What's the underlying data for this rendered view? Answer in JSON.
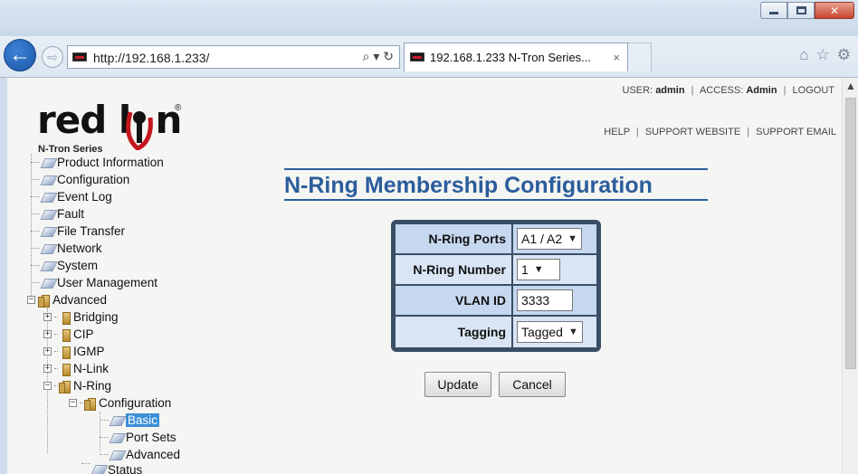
{
  "browser": {
    "url": "http://192.168.1.233/",
    "tab_title": "192.168.1.233 N-Tron Series...",
    "tab_close": "×",
    "search_glyph": "⌕ ▾ ↻",
    "icons": [
      "back-arrow-icon",
      "forward-arrow-icon",
      "home-icon",
      "star-icon",
      "gear-icon"
    ]
  },
  "logo": {
    "brand": "red lion",
    "subtitle": "N-Tron Series"
  },
  "header": {
    "user_label": "USER:",
    "user_value": "admin",
    "access_label": "ACCESS:",
    "access_value": "Admin",
    "logout": "LOGOUT",
    "help": "HELP",
    "support_website": "SUPPORT WEBSITE",
    "support_email": "SUPPORT EMAIL"
  },
  "tree": {
    "product_information": "Product Information",
    "configuration": "Configuration",
    "event_log": "Event Log",
    "fault": "Fault",
    "file_transfer": "File Transfer",
    "network": "Network",
    "system": "System",
    "user_management": "User Management",
    "advanced": "Advanced",
    "bridging": "Bridging",
    "cip": "CIP",
    "igmp": "IGMP",
    "nlink": "N-Link",
    "nring": "N-Ring",
    "nring_configuration": "Configuration",
    "basic": "Basic",
    "port_sets": "Port Sets",
    "adv": "Advanced",
    "status": "Status"
  },
  "main": {
    "title": "N-Ring Membership Configuration",
    "fields": {
      "ports_label": "N-Ring Ports",
      "ports_value": "A1 / A2",
      "number_label": "N-Ring Number",
      "number_value": "1",
      "vlan_label": "VLAN ID",
      "vlan_value": "3333",
      "tagging_label": "Tagging",
      "tagging_value": "Tagged"
    },
    "update_button": "Update",
    "cancel_button": "Cancel"
  }
}
